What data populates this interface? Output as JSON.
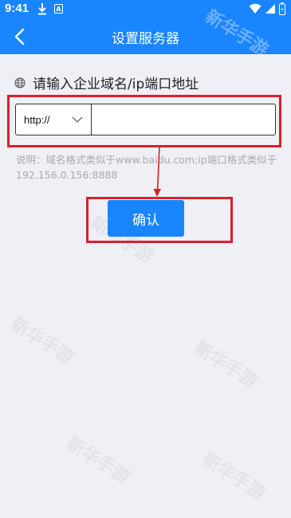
{
  "status_bar": {
    "time": "9:41",
    "icons": [
      "download-icon",
      "a-icon",
      "wifi-icon",
      "signal-icon",
      "battery-icon"
    ],
    "a_letter": "A"
  },
  "nav": {
    "title": "设置服务器",
    "back_icon": "chevron-left-icon"
  },
  "form": {
    "section_label": "请输入企业域名/ip端口地址",
    "section_icon": "globe-icon",
    "protocol": {
      "value": "http://",
      "icon": "chevron-down-icon"
    },
    "address_input": {
      "value": "",
      "placeholder": ""
    },
    "hint": "说明：域名格式类似于www.baidu.com;ip端口格式类似于192.156.0.156:8888",
    "confirm_label": "确认"
  },
  "watermark": "新华手游",
  "colors": {
    "primary": "#1985ff",
    "background": "#eef0f5",
    "annotation_red": "#d9202a",
    "hint_gray": "#a8aab0"
  }
}
